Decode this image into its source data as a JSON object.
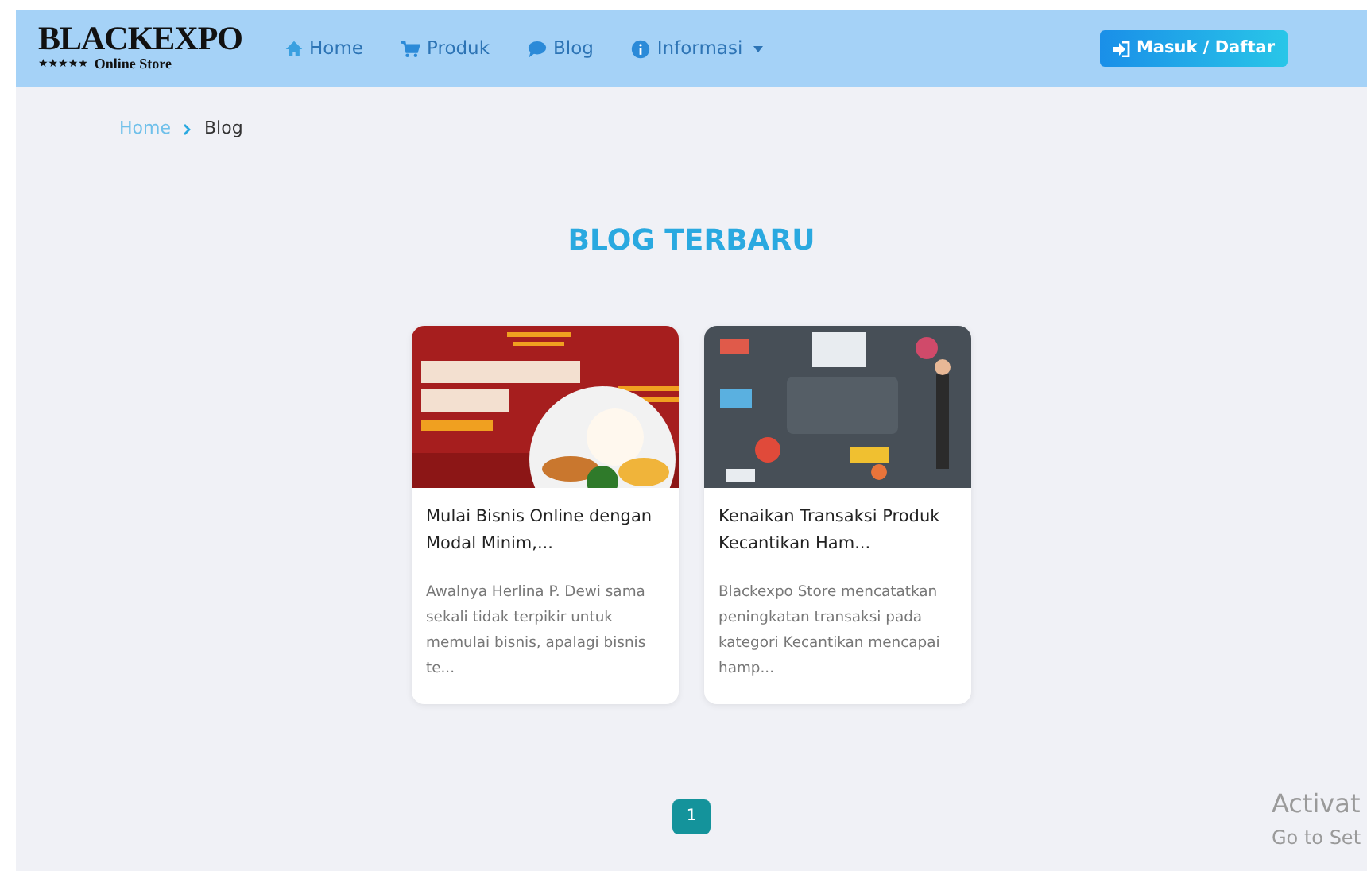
{
  "navbar": {
    "brand": {
      "name": "BLACKEXPO",
      "tagline": "Online Store",
      "stars": "★★★★★"
    },
    "links": [
      {
        "label": "Home",
        "kind": "home",
        "dropdown": false
      },
      {
        "label": "Produk",
        "kind": "cart",
        "dropdown": false
      },
      {
        "label": "Blog",
        "kind": "chat",
        "dropdown": false
      },
      {
        "label": "Informasi",
        "kind": "info",
        "dropdown": true
      }
    ],
    "login_button": "Masuk / Daftar"
  },
  "breadcrumb": [
    {
      "label": "Home",
      "active": false
    },
    {
      "label": "Blog",
      "active": true
    }
  ],
  "heading": "BLOG TERBARU",
  "posts": [
    {
      "kind": "food",
      "title": "Mulai Bisnis Online dengan Modal Minim,...",
      "excerpt": "Awalnya Herlina P. Dewi sama sekali tidak terpikir untuk memulai bisnis, apalagi bisnis te..."
    },
    {
      "kind": "marketing",
      "title": "Kenaikan Transaksi Produk Kecantikan Ham...",
      "excerpt": "Blackexpo Store mencatatkan peningkatan transaksi pada kategori Kecantikan mencapai hamp..."
    }
  ],
  "pagination": [
    {
      "label": "1",
      "selected": true
    }
  ],
  "activation_notice": {
    "title": "Activat",
    "subtitle": "Go to Set"
  }
}
